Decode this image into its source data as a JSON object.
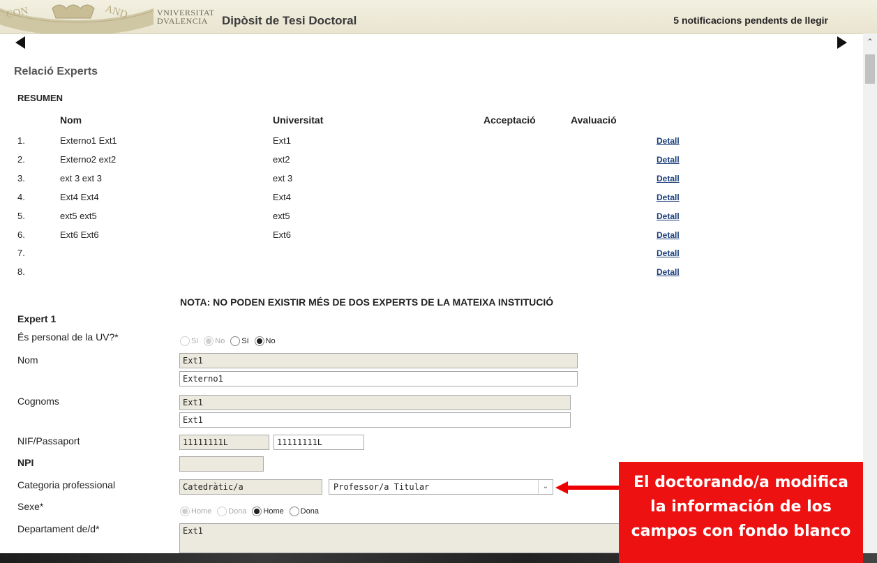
{
  "header": {
    "logo_text_line1": "VNIVERSITAT",
    "logo_text_line2": "DVALENCIA",
    "seal_text": "CONVENTUS EXANDI",
    "app_title": "Dipòsit de Tesi Doctoral",
    "notifications": "5 notificacions pendents de llegir"
  },
  "section_title": "Relació Experts",
  "resumen": {
    "title": "RESUMEN",
    "headers": {
      "nom": "Nom",
      "universitat": "Universitat",
      "acceptacio": "Acceptació",
      "avaluacio": "Avaluació"
    },
    "rows": [
      {
        "num": "1.",
        "nom": "Externo1 Ext1",
        "universitat": "Ext1",
        "detail": "Detall"
      },
      {
        "num": "2.",
        "nom": "Externo2 ext2",
        "universitat": "ext2",
        "detail": "Detall"
      },
      {
        "num": "3.",
        "nom": "ext 3 ext 3",
        "universitat": "ext 3",
        "detail": "Detall"
      },
      {
        "num": "4.",
        "nom": "Ext4 Ext4",
        "universitat": "Ext4",
        "detail": "Detall"
      },
      {
        "num": "5.",
        "nom": "ext5 ext5",
        "universitat": "ext5",
        "detail": "Detall"
      },
      {
        "num": "6.",
        "nom": "Ext6 Ext6",
        "universitat": "Ext6",
        "detail": "Detall"
      },
      {
        "num": "7.",
        "nom": "",
        "universitat": "",
        "detail": "Detall"
      },
      {
        "num": "8.",
        "nom": "",
        "universitat": "",
        "detail": "Detall"
      }
    ]
  },
  "nota": "NOTA: NO PODEN EXISTIR MÉS DE DOS EXPERTS DE LA MATEIXA INSTITUCIÓ",
  "expert": {
    "title": "Expert 1",
    "uv_label": "És personal de la UV?*",
    "uv_options": [
      "Sí",
      "No",
      "Sí",
      "No"
    ],
    "nom_label": "Nom",
    "nom_original": "Ext1",
    "nom_value": "Externo1",
    "cognoms_label": "Cognoms",
    "cognoms_original": "Ext1",
    "cognoms_value": "Ext1",
    "nif_label": "NIF/Passaport",
    "nif_original": "11111111L",
    "nif_value": "11111111L",
    "npi_label": "NPI",
    "npi_original": "",
    "categoria_label": "Categoria professional",
    "categoria_original": "Catedràtic/a",
    "categoria_selected": "Professor/a Titular",
    "sexe_label": "Sexe*",
    "sexe_options": [
      "Home",
      "Dona",
      "Home",
      "Dona"
    ],
    "departament_label": "Departament de/d*",
    "departament_original": "Ext1"
  },
  "callout": {
    "line1": "El doctorando/a modifica",
    "line2": "la información de los",
    "line3": "campos con fondo blanco"
  },
  "colors": {
    "callout": "#ee1111",
    "readonly_field": "#eceadf",
    "header_bg": "#efebd8",
    "link": "#1a3e7a"
  }
}
